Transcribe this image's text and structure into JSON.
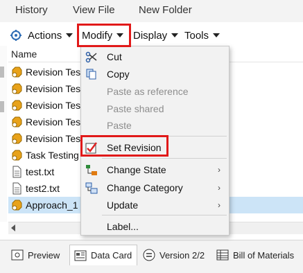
{
  "top_tabs": [
    "History",
    "View File",
    "New Folder"
  ],
  "toolbar": {
    "actions_label": "Actions",
    "modify_label": "Modify",
    "display_label": "Display",
    "tools_label": "Tools"
  },
  "list": {
    "column_name": "Name",
    "rows": [
      {
        "label": "Revision Tes",
        "icon": "revision-icon"
      },
      {
        "label": "Revision Tes",
        "icon": "revision-icon"
      },
      {
        "label": "Revision Tes",
        "icon": "revision-icon"
      },
      {
        "label": "Revision Tes",
        "icon": "revision-icon"
      },
      {
        "label": "Revision Tes",
        "icon": "revision-icon"
      },
      {
        "label": "Task Testing",
        "icon": "revision-icon"
      },
      {
        "label": "test.txt",
        "icon": "file-icon"
      },
      {
        "label": "test2.txt",
        "icon": "file-icon"
      },
      {
        "label": "Approach_1",
        "icon": "revision-icon",
        "selected": true
      }
    ]
  },
  "menu": {
    "items": [
      {
        "label": "Cut",
        "icon": "scissors-icon",
        "enabled": true
      },
      {
        "label": "Copy",
        "icon": "copy-icon",
        "enabled": true
      },
      {
        "label": "Paste as reference",
        "enabled": false
      },
      {
        "label": "Paste shared",
        "enabled": false
      },
      {
        "label": "Paste",
        "enabled": false
      },
      {
        "label": "Set Revision",
        "icon": "checkmark-icon",
        "enabled": true,
        "highlighted": true
      },
      {
        "label": "Change State",
        "icon": "state-icon",
        "enabled": true,
        "submenu": true
      },
      {
        "label": "Change Category",
        "icon": "category-icon",
        "enabled": true,
        "submenu": true
      },
      {
        "label": "Update",
        "enabled": true,
        "submenu": true
      },
      {
        "label": "Label...",
        "enabled": true
      }
    ],
    "submenu_glyph": "›"
  },
  "bottom_tabs": [
    {
      "label": "Preview",
      "icon": "preview-icon"
    },
    {
      "label": "Data Card",
      "icon": "data-card-icon",
      "active": true
    },
    {
      "label": "Version 2/2",
      "icon": "version-icon"
    },
    {
      "label": "Bill of Materials",
      "icon": "table-icon"
    }
  ],
  "colors": {
    "highlight": "#e11919",
    "selection": "#cce4f7",
    "revision_icon": "#e8a21a"
  }
}
